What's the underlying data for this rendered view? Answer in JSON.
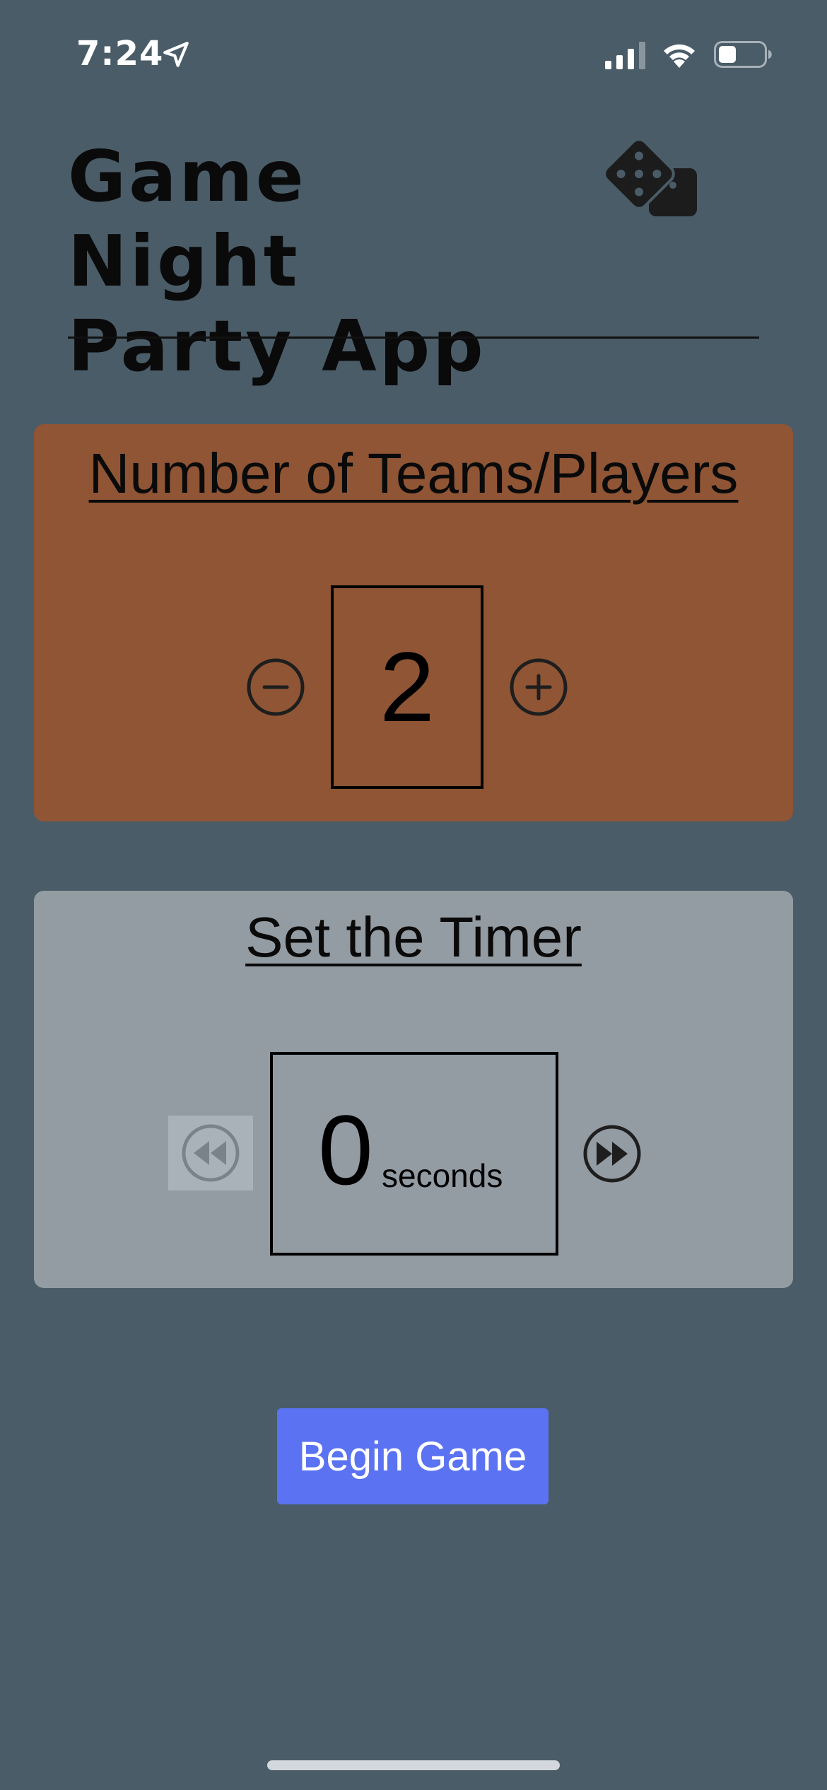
{
  "status_bar": {
    "time": "7:24",
    "location_icon": "location-arrow-icon",
    "signal_icon": "cellular-signal-icon",
    "wifi_icon": "wifi-icon",
    "battery_icon": "battery-icon",
    "battery_level": 0.35
  },
  "header": {
    "title_line1": "Game Night",
    "title_line2": "Party App",
    "logo_icon": "dice-icon"
  },
  "teams_card": {
    "heading": "Number of Teams/Players",
    "value": "2",
    "decrement_icon": "minus-circle-icon",
    "increment_icon": "plus-circle-icon",
    "background": "#8f5535"
  },
  "timer_card": {
    "heading": "Set the Timer",
    "value": "0",
    "unit": "seconds",
    "rewind_icon": "rewind-circle-icon",
    "forward_icon": "fast-forward-circle-icon",
    "rewind_disabled": true,
    "background": "#939ba3"
  },
  "actions": {
    "begin_label": "Begin Game",
    "begin_color": "#5b73f2"
  },
  "theme": {
    "background": "#4a5c67"
  }
}
